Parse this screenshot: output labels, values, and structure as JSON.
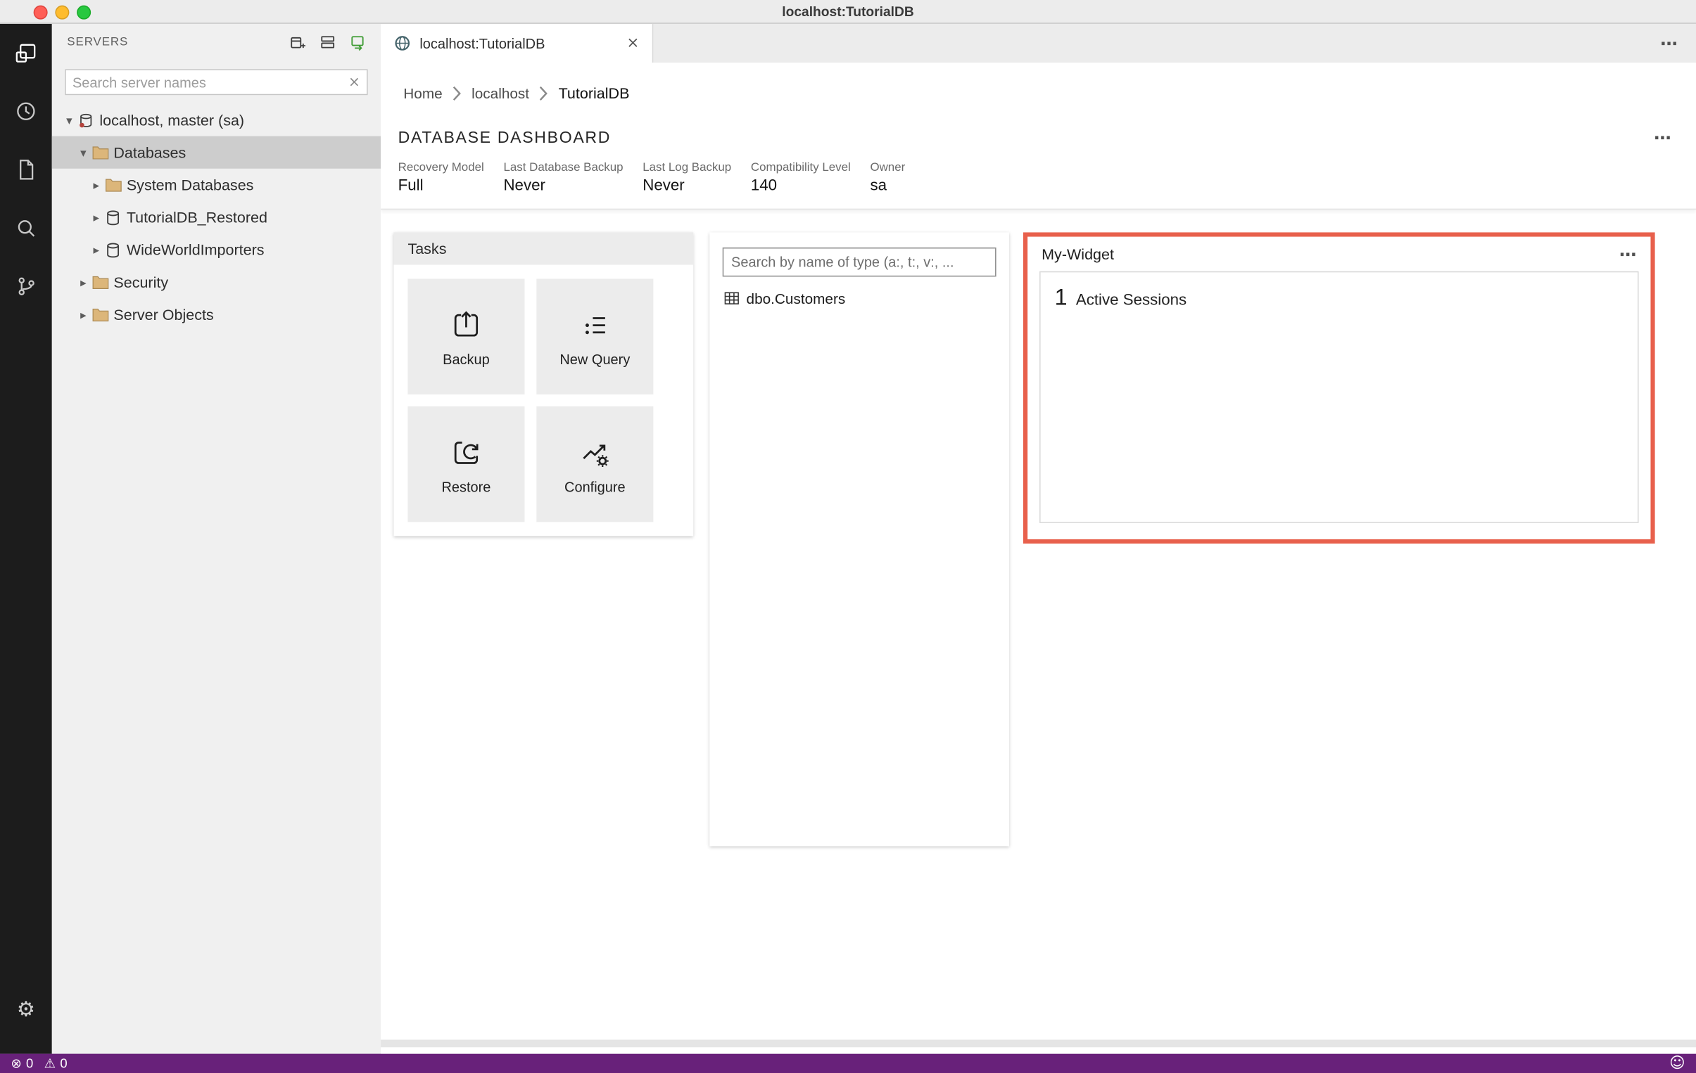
{
  "window": {
    "title": "localhost:TutorialDB"
  },
  "icons": {
    "more": "⋯",
    "close": "×",
    "clear": "×",
    "chevron_expanded": "▾",
    "chevron_collapsed": "▸",
    "gear": "⚙",
    "error": "⊗",
    "warning": "⚠",
    "smiley": "☺"
  },
  "activity_bar": {
    "items": [
      "connections-icon",
      "task-history-icon",
      "file-icon",
      "search-icon",
      "source-control-icon",
      "settings-gear-icon"
    ]
  },
  "sidebar": {
    "title": "SERVERS",
    "search_placeholder": "Search server names",
    "tree": [
      {
        "label": "localhost, master (sa)",
        "level": 0,
        "icon": "server",
        "expanded": true
      },
      {
        "label": "Databases",
        "level": 1,
        "icon": "folder",
        "expanded": true,
        "selected": true
      },
      {
        "label": "System Databases",
        "level": 2,
        "icon": "folder",
        "expanded": false
      },
      {
        "label": "TutorialDB_Restored",
        "level": 2,
        "icon": "database",
        "expanded": false
      },
      {
        "label": "WideWorldImporters",
        "level": 2,
        "icon": "database",
        "expanded": false
      },
      {
        "label": "Security",
        "level": 1,
        "icon": "folder",
        "expanded": false
      },
      {
        "label": "Server Objects",
        "level": 1,
        "icon": "folder",
        "expanded": false
      }
    ]
  },
  "editor": {
    "tab_title": "localhost:TutorialDB",
    "breadcrumb": [
      "Home",
      "localhost",
      "TutorialDB"
    ],
    "dashboard_title": "DATABASE DASHBOARD",
    "properties": [
      {
        "label": "Recovery Model",
        "value": "Full"
      },
      {
        "label": "Last Database Backup",
        "value": "Never"
      },
      {
        "label": "Last Log Backup",
        "value": "Never"
      },
      {
        "label": "Compatibility Level",
        "value": "140"
      },
      {
        "label": "Owner",
        "value": "sa"
      }
    ],
    "tasks": {
      "title": "Tasks",
      "buttons": [
        "Backup",
        "New Query",
        "Restore",
        "Configure"
      ]
    },
    "explorer": {
      "search_placeholder": "Search by name of type (a:, t:, v:, ...",
      "items": [
        "dbo.Customers"
      ]
    },
    "my_widget": {
      "title": "My-Widget",
      "count": "1",
      "label": "Active Sessions",
      "highlight_color": "#e8604c"
    }
  },
  "status_bar": {
    "errors": "0",
    "warnings": "0"
  }
}
